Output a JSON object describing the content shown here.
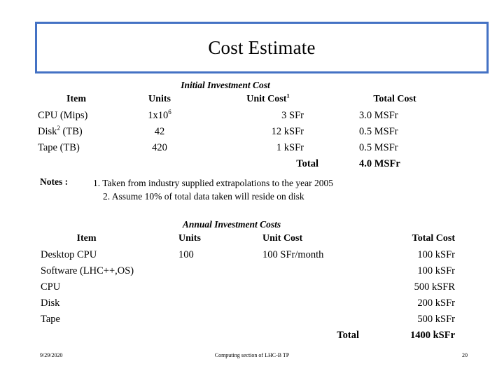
{
  "slide": {
    "title": "Cost Estimate",
    "accent_color": "#4472C4"
  },
  "initial_section": {
    "caption": "Initial Investment Cost",
    "headers": {
      "item": "Item",
      "units": "Units",
      "unit_cost": "Unit Cost",
      "unit_cost_note": "1",
      "total_cost": "Total Cost"
    },
    "rows": [
      {
        "item": "CPU (Mips)",
        "units": "1x10",
        "units_sup": "6",
        "unit_cost": "3  SFr",
        "total_cost": "3.0 MSFr"
      },
      {
        "item": "Disk",
        "item_sup": "2",
        "item_tail": " (TB)",
        "units": "42",
        "unit_cost": "12 kSFr",
        "total_cost": "0.5 MSFr"
      },
      {
        "item": "Tape (TB)",
        "units": "420",
        "unit_cost": "1 kSFr",
        "total_cost": "0.5 MSFr"
      }
    ],
    "total_label": "Total",
    "total_value": "4.0 MSFr"
  },
  "notes": {
    "label": "Notes :",
    "items": [
      "1. Taken from industry supplied extrapolations to the year 2005",
      "2. Assume 10% of total data taken will reside on disk"
    ]
  },
  "annual_section": {
    "caption": "Annual Investment Costs",
    "headers": {
      "item": "Item",
      "units": "Units",
      "unit_cost": "Unit Cost",
      "total_cost": "Total Cost"
    },
    "rows": [
      {
        "item": "Desktop CPU",
        "units": "100",
        "unit_cost": "100 SFr/month",
        "total_cost": "100 kSFr"
      },
      {
        "item": "Software   (LHC++,OS)",
        "units": "",
        "unit_cost": "",
        "total_cost": "100 kSFr"
      },
      {
        "item": "CPU",
        "units": "",
        "unit_cost": "",
        "total_cost": "500 kSFR"
      },
      {
        "item": "Disk",
        "units": "",
        "unit_cost": "",
        "total_cost": "200 kSFr"
      },
      {
        "item": "Tape",
        "units": "",
        "unit_cost": "",
        "total_cost": "500 kSFr"
      }
    ],
    "total_label": "Total",
    "total_value": "1400 kSFr"
  },
  "footer": {
    "date": "9/29/2020",
    "center": "Computing section of LHC-B TP",
    "page": "20"
  }
}
